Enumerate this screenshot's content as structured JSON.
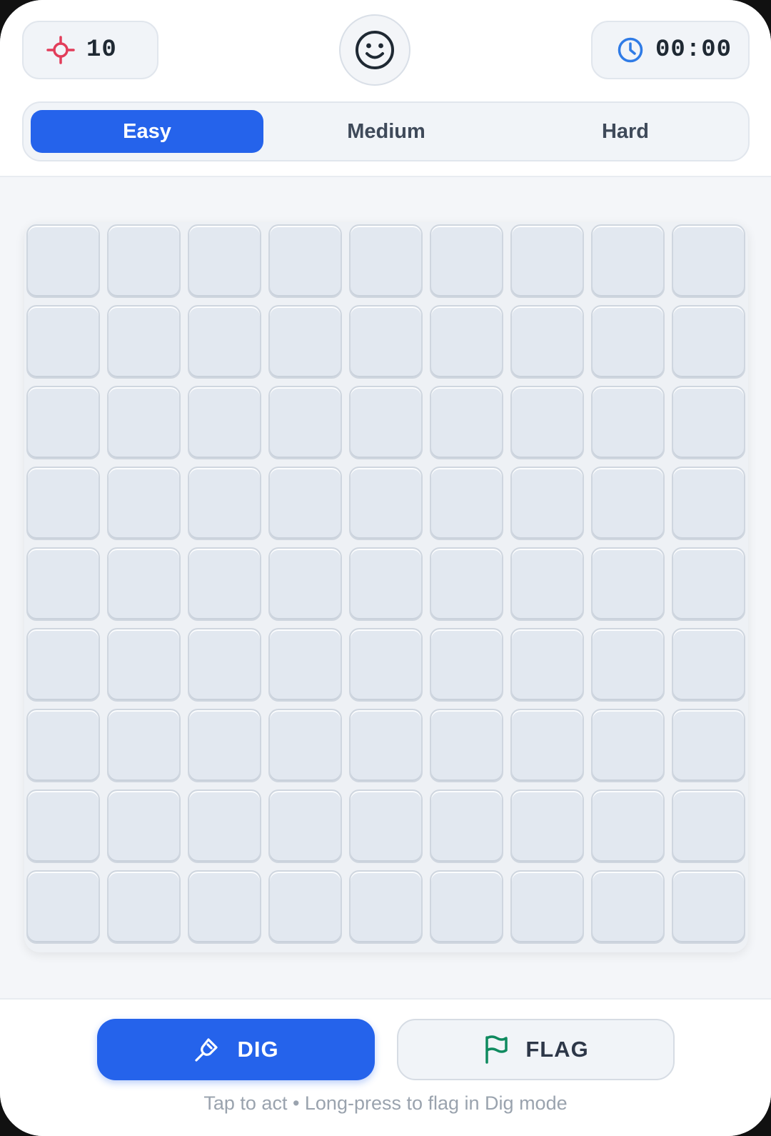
{
  "header": {
    "mines_remaining": "10",
    "timer": "00:00",
    "face_icon": "smiley-face-icon",
    "mine_icon": "crosshair-icon",
    "timer_icon": "clock-icon"
  },
  "difficulty": {
    "tabs": [
      {
        "label": "Easy",
        "active": true
      },
      {
        "label": "Medium",
        "active": false
      },
      {
        "label": "Hard",
        "active": false
      }
    ]
  },
  "board": {
    "rows": 9,
    "cols": 9,
    "cells_state": "all-hidden"
  },
  "controls": {
    "dig_label": "DIG",
    "flag_label": "FLAG",
    "dig_icon": "shovel-icon",
    "flag_icon": "flag-icon",
    "active_mode": "dig",
    "hint": "Tap to act • Long-press to flag in Dig mode"
  },
  "colors": {
    "accent": "#2563eb",
    "mine_icon": "#e23d5a",
    "timer_icon": "#2f7be6",
    "flag_icon": "#0f8a5f"
  }
}
